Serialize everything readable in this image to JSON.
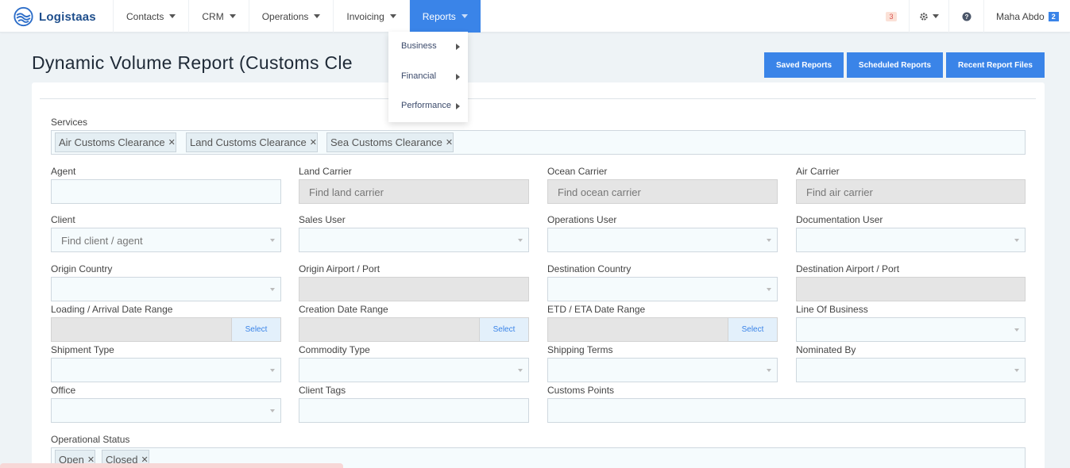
{
  "brand": {
    "name": "Logistaas"
  },
  "nav": {
    "items": [
      {
        "label": "Contacts"
      },
      {
        "label": "CRM"
      },
      {
        "label": "Operations"
      },
      {
        "label": "Invoicing"
      },
      {
        "label": "Reports"
      }
    ],
    "notifications_count": "3",
    "user_name": "Maha Abdo",
    "user_badge": "2"
  },
  "reports_menu": {
    "items": [
      {
        "label": "Business"
      },
      {
        "label": "Financial"
      },
      {
        "label": "Performance"
      }
    ]
  },
  "page": {
    "title": "Dynamic Volume Report (Customs Cle",
    "buttons": {
      "saved": "Saved Reports",
      "scheduled": "Scheduled Reports",
      "recent": "Recent Report Files"
    }
  },
  "form": {
    "services": {
      "label": "Services",
      "tags": [
        "Air Customs Clearance",
        "Land Customs Clearance",
        "Sea Customs Clearance"
      ]
    },
    "agent": {
      "label": "Agent",
      "value": ""
    },
    "land_carrier": {
      "label": "Land Carrier",
      "placeholder": "Find land carrier"
    },
    "ocean_carrier": {
      "label": "Ocean Carrier",
      "placeholder": "Find ocean carrier"
    },
    "air_carrier": {
      "label": "Air Carrier",
      "placeholder": "Find air carrier"
    },
    "client": {
      "label": "Client",
      "placeholder": "Find client / agent"
    },
    "sales_user": {
      "label": "Sales User"
    },
    "operations_user": {
      "label": "Operations User"
    },
    "documentation_user": {
      "label": "Documentation User"
    },
    "origin_country": {
      "label": "Origin Country"
    },
    "origin_port": {
      "label": "Origin Airport / Port"
    },
    "destination_country": {
      "label": "Destination Country"
    },
    "destination_port": {
      "label": "Destination Airport / Port"
    },
    "loading_date": {
      "label": "Loading / Arrival Date Range",
      "button": "Select"
    },
    "creation_date": {
      "label": "Creation Date Range",
      "button": "Select"
    },
    "etd_date": {
      "label": "ETD / ETA Date Range",
      "button": "Select"
    },
    "line_of_business": {
      "label": "Line Of Business"
    },
    "shipment_type": {
      "label": "Shipment Type"
    },
    "commodity_type": {
      "label": "Commodity Type"
    },
    "shipping_terms": {
      "label": "Shipping Terms"
    },
    "nominated_by": {
      "label": "Nominated By"
    },
    "office": {
      "label": "Office"
    },
    "client_tags": {
      "label": "Client Tags"
    },
    "customs_points": {
      "label": "Customs Points"
    },
    "operational_status": {
      "label": "Operational Status",
      "tags": [
        "Open",
        "Closed"
      ]
    }
  },
  "colors": {
    "primary": "#3a84e8",
    "brand": "#1e4e8c"
  }
}
